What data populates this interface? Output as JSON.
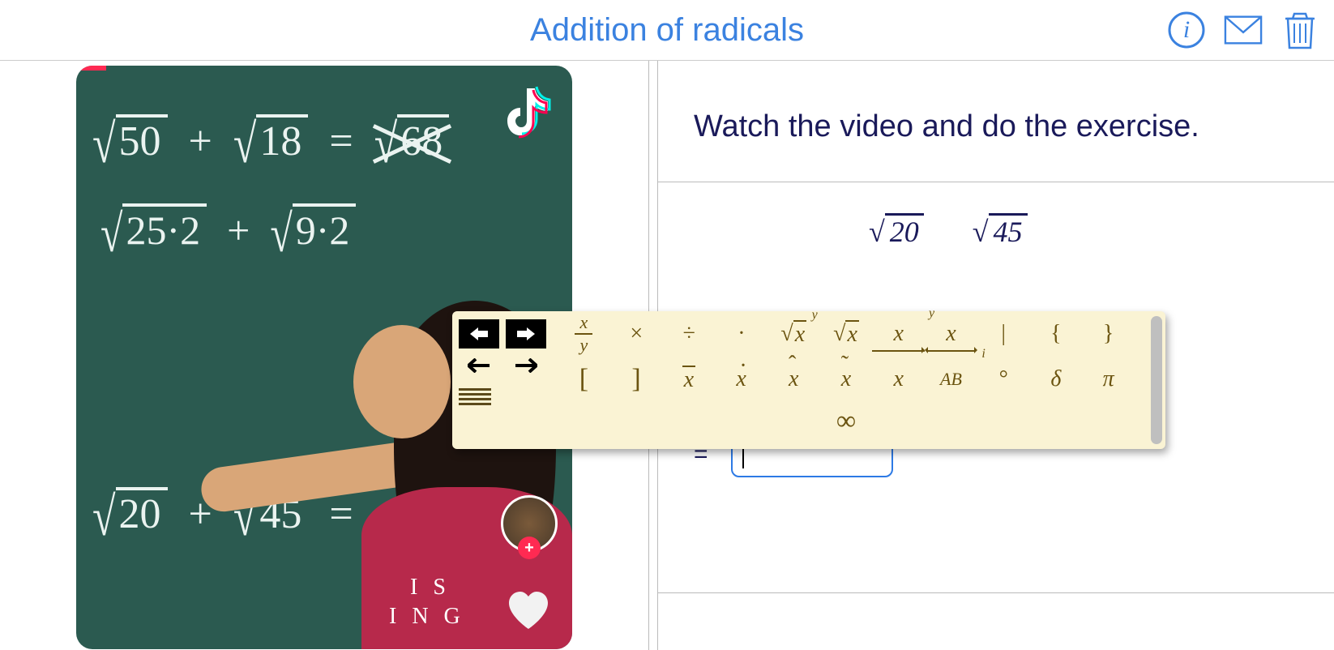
{
  "header": {
    "title": "Addition of radicals",
    "icons": {
      "info": "info",
      "mail": "mail",
      "trash": "trash"
    }
  },
  "video": {
    "progress_percent": 6,
    "chalk_lines": {
      "line1_a": "50",
      "line1_b": "18",
      "line1_crossed": "68",
      "line2_a": "25·2",
      "line2_b": "9·2",
      "line3_a": "20",
      "line3_b": "45"
    },
    "shirt_text_1": "I S",
    "shirt_text_2": "I N G",
    "avatar_plus": "+"
  },
  "instructions": "Watch the video and do the exercise.",
  "exercise": {
    "hidden_r1": "20",
    "hidden_r2": "45",
    "equals": "=",
    "input1_value": "",
    "input2_value": ""
  },
  "toolbar": {
    "row1": {
      "frac_num": "x",
      "frac_den": "y",
      "times": "×",
      "divide": "÷",
      "dot": "·",
      "sqrt_label": "x",
      "nthroot_label": "x",
      "nthroot_index": "y",
      "power_base": "x",
      "power_exp": "y",
      "sub_base": "x",
      "sub_idx": "i",
      "pipe": "|",
      "lbrace": "{",
      "rbrace": "}"
    },
    "row2": {
      "lbracket": "[",
      "rbracket": "]",
      "xbar": "x",
      "xdot": "x",
      "xhat": "x",
      "xtilde": "x",
      "xarrow": "x",
      "vec_ab": "AB",
      "degree": "°",
      "delta": "δ",
      "pi": "π"
    },
    "row3": {
      "infinity": "∞"
    }
  }
}
